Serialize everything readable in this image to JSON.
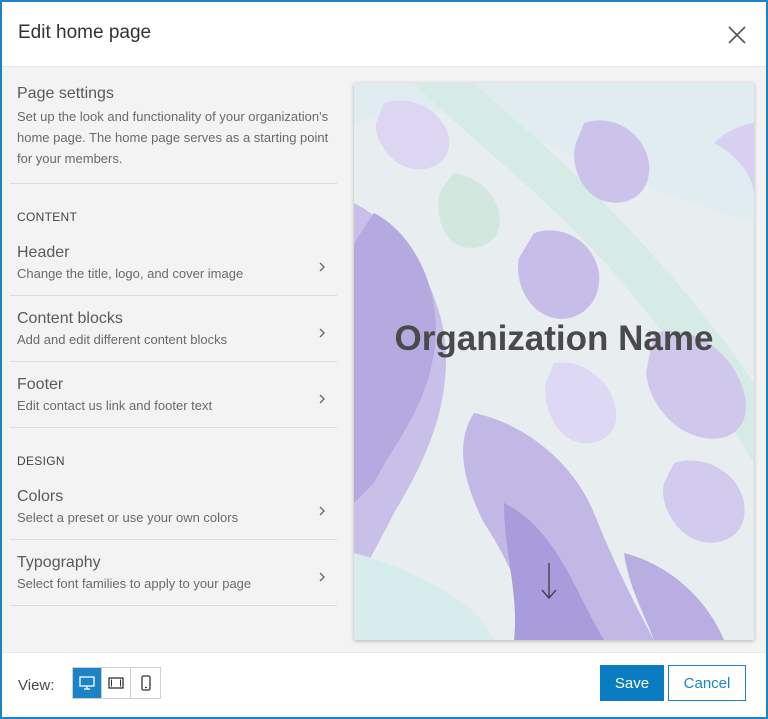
{
  "dialog": {
    "title": "Edit home page",
    "close_icon": "close-icon"
  },
  "intro": {
    "title": "Page settings",
    "description": "Set up the look and functionality of your organization's home page. The home page serves as a starting point for your members."
  },
  "sections": {
    "content": {
      "label": "CONTENT",
      "items": [
        {
          "title": "Header",
          "description": "Change the title, logo, and cover image"
        },
        {
          "title": "Content blocks",
          "description": "Add and edit different content blocks"
        },
        {
          "title": "Footer",
          "description": "Edit contact us link and footer text"
        }
      ]
    },
    "design": {
      "label": "DESIGN",
      "items": [
        {
          "title": "Colors",
          "description": "Select a preset or use your own colors"
        },
        {
          "title": "Typography",
          "description": "Select font families to apply to your page"
        }
      ]
    }
  },
  "preview": {
    "org_name": "Organization Name",
    "scroll_icon": "arrow-down-icon"
  },
  "footer": {
    "view_label": "View:",
    "view_modes": [
      {
        "name": "desktop",
        "icon": "desktop-icon",
        "active": true
      },
      {
        "name": "tablet",
        "icon": "tablet-icon",
        "active": false
      },
      {
        "name": "phone",
        "icon": "phone-icon",
        "active": false
      }
    ],
    "save_label": "Save",
    "cancel_label": "Cancel"
  },
  "colors": {
    "accent": "#1b84c6",
    "primary_button": "#0a7cc1"
  }
}
